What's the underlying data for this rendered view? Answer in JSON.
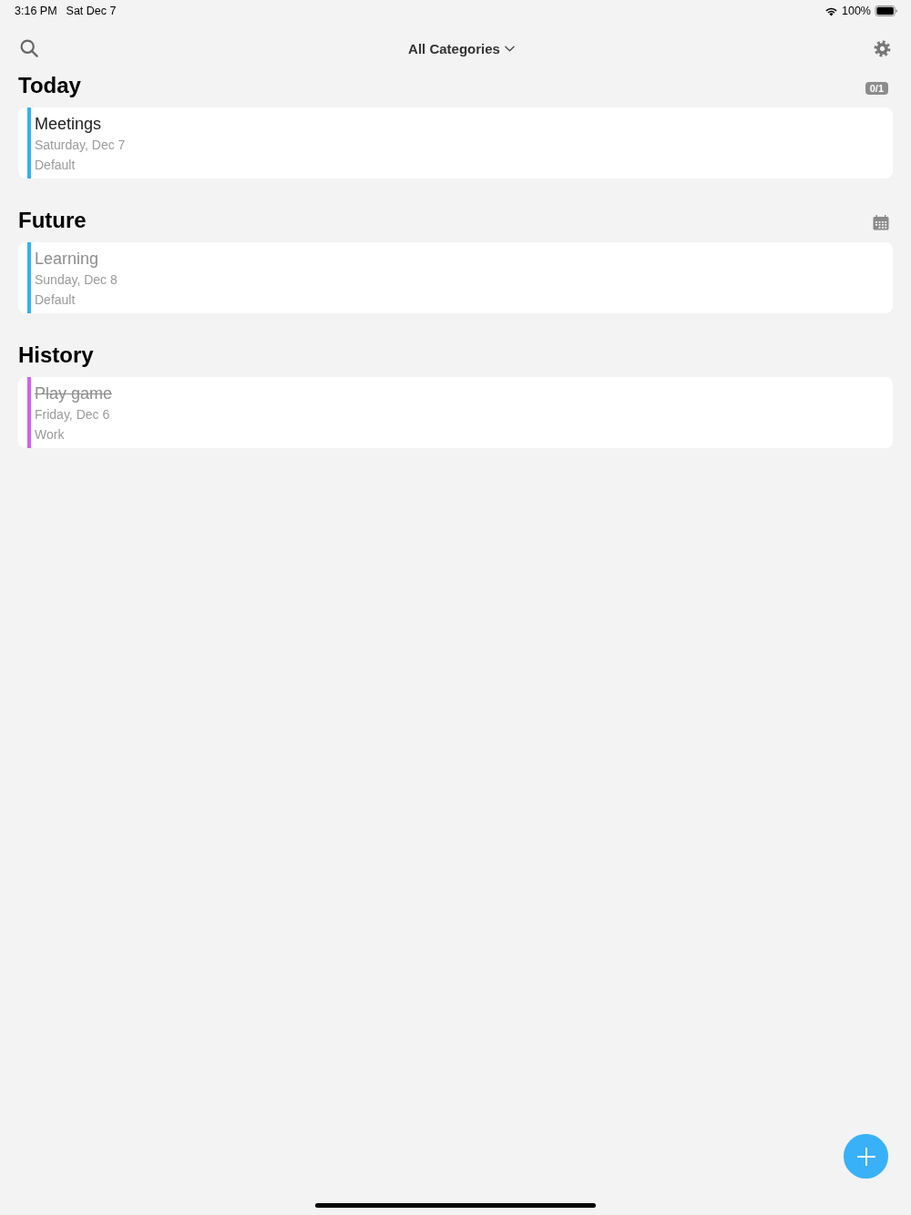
{
  "status_bar": {
    "time": "3:16 PM",
    "date": "Sat Dec 7",
    "battery": "100%"
  },
  "nav": {
    "filter": "All Categories"
  },
  "sections": [
    {
      "title": "Today",
      "badge": "0/1",
      "calendar": false,
      "tasks": [
        {
          "title": "Meetings",
          "date": "Saturday, Dec 7",
          "category": "Default",
          "color": "#2db3fa",
          "dimmed": false,
          "completed": false
        }
      ]
    },
    {
      "title": "Future",
      "calendar": true,
      "tasks": [
        {
          "title": "Learning",
          "date": "Sunday, Dec 8",
          "category": "Default",
          "color": "#2db3fa",
          "dimmed": true,
          "completed": false
        }
      ]
    },
    {
      "title": "History",
      "calendar": false,
      "tasks": [
        {
          "title": "Play game",
          "date": "Friday, Dec 6",
          "category": "Work",
          "color": "#d65ef7",
          "dimmed": true,
          "completed": true
        }
      ]
    }
  ]
}
